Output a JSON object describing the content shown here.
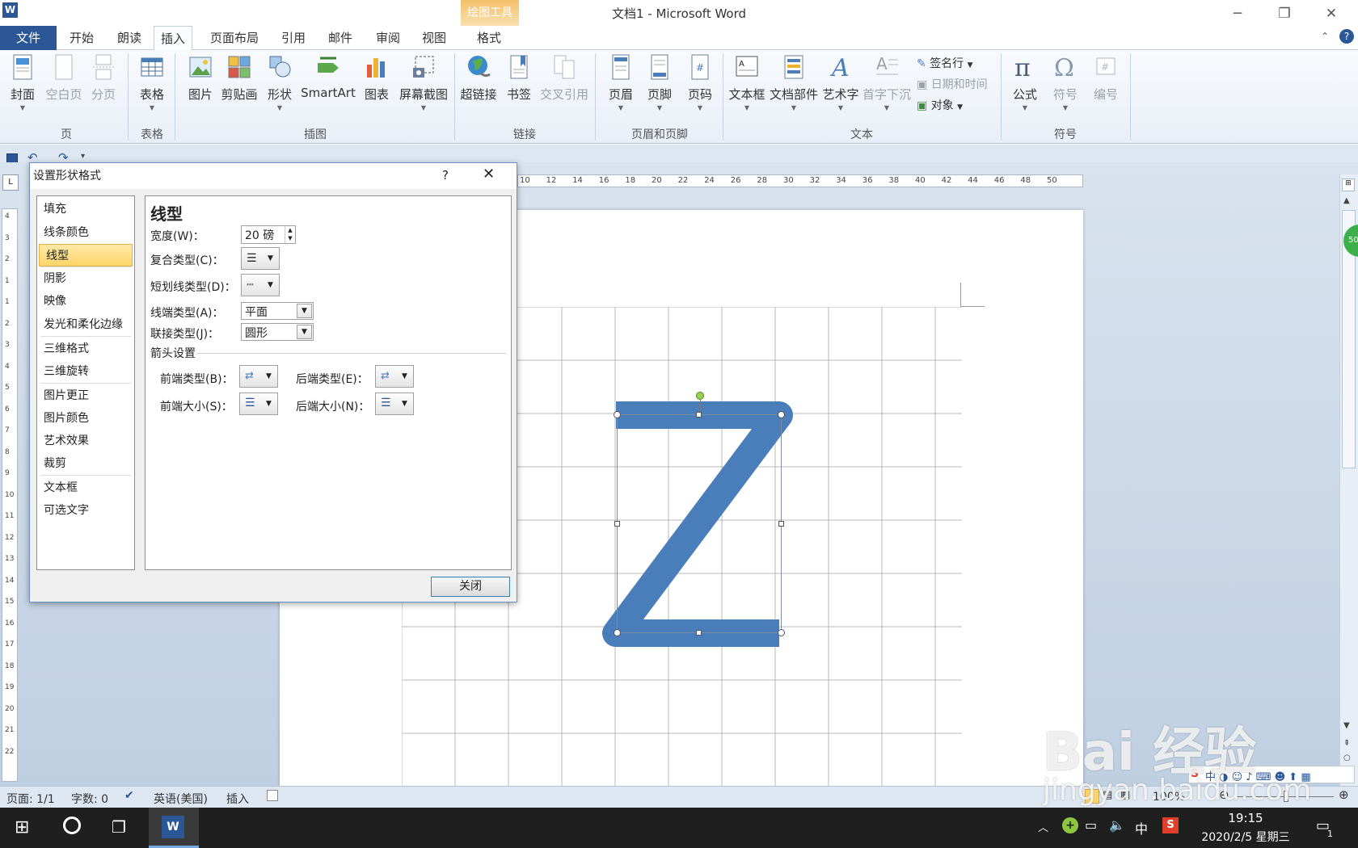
{
  "window": {
    "title": "文档1 - Microsoft Word",
    "app_icon": "W",
    "controls": [
      "─",
      "❐",
      "✕"
    ]
  },
  "context_tab": {
    "header": "绘图工具",
    "tab": "格式"
  },
  "tabs": [
    "文件",
    "开始",
    "朗读",
    "插入",
    "页面布局",
    "引用",
    "邮件",
    "审阅",
    "视图"
  ],
  "active_tab": "插入",
  "ribbon": {
    "groups": {
      "page": {
        "label": "页",
        "buttons": [
          "封面",
          "空白页",
          "分页"
        ]
      },
      "table": {
        "label": "表格",
        "buttons": [
          "表格"
        ]
      },
      "illustrations": {
        "label": "插图",
        "buttons": [
          "图片",
          "剪贴画",
          "形状",
          "SmartArt",
          "图表",
          "屏幕截图"
        ]
      },
      "links": {
        "label": "链接",
        "buttons": [
          "超链接",
          "书签",
          "交叉引用"
        ]
      },
      "header_footer": {
        "label": "页眉和页脚",
        "buttons": [
          "页眉",
          "页脚",
          "页码"
        ]
      },
      "text": {
        "label": "文本",
        "buttons": [
          "文本框",
          "文档部件",
          "艺术字",
          "首字下沉"
        ],
        "small": [
          "签名行",
          "日期和时间",
          "对象"
        ]
      },
      "symbols": {
        "label": "符号",
        "buttons": [
          "公式",
          "符号",
          "编号"
        ]
      }
    }
  },
  "ruler": {
    "ticks": [
      "10",
      "12",
      "14",
      "16",
      "18",
      "20",
      "22",
      "24",
      "26",
      "28",
      "30",
      "32",
      "34",
      "36",
      "38",
      "40",
      "42",
      "44",
      "46",
      "48",
      "50"
    ],
    "vticks": [
      "4",
      "3",
      "2",
      "1",
      "1",
      "2",
      "3",
      "4",
      "5",
      "6",
      "7",
      "8",
      "9",
      "10",
      "11",
      "12",
      "13",
      "14",
      "15",
      "16",
      "17",
      "18",
      "19",
      "20",
      "21",
      "22"
    ],
    "corner": "L"
  },
  "dialog": {
    "title": "设置形状格式",
    "help": "?",
    "nav": [
      "填充",
      "线条颜色",
      "线型",
      "阴影",
      "映像",
      "发光和柔化边缘",
      "三维格式",
      "三维旋转",
      "图片更正",
      "图片颜色",
      "艺术效果",
      "裁剪",
      "文本框",
      "可选文字"
    ],
    "selected_nav": "线型",
    "panel": {
      "heading": "线型",
      "width_label": "宽度(W)：",
      "width_value": "20 磅",
      "compound_label": "复合类型(C)：",
      "dash_label": "短划线类型(D)：",
      "cap_label": "线端类型(A)：",
      "cap_value": "平面",
      "join_label": "联接类型(J)：",
      "join_value": "圆形",
      "arrow_section": "箭头设置",
      "begin_type": "前端类型(B)：",
      "end_type": "后端类型(E)：",
      "begin_size": "前端大小(S)：",
      "end_size": "后端大小(N)："
    },
    "close": "关闭"
  },
  "statusbar": {
    "page": "页面: 1/1",
    "words": "字数: 0",
    "language": "英语(美国)",
    "mode": "插入",
    "zoom": "100%"
  },
  "taskbar": {
    "time": "19:15",
    "date": "2020/2/5 星期三",
    "ime": "中",
    "notif_count": "1"
  },
  "watermark": {
    "text": "Bai 经验",
    "url": "jingyan.baidu.com"
  },
  "colors": {
    "shape": "#4a7ebb",
    "accent": "#2b5797",
    "context": "#f4c06a"
  }
}
